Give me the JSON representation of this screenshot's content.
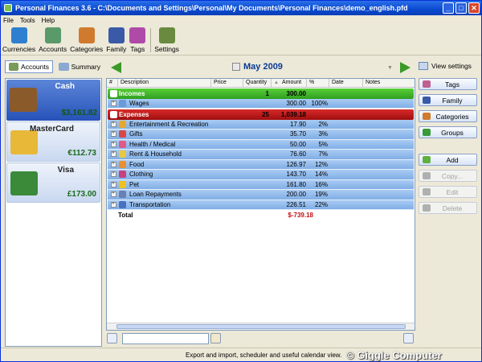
{
  "window": {
    "title": "Personal Finances 3.6 - C:\\Documents and Settings\\Personal\\My Documents\\Personal Finances\\demo_english.pfd",
    "minimize": "_",
    "maximize": "□",
    "close": "✕"
  },
  "menu": [
    "File",
    "Tools",
    "Help"
  ],
  "toolbar": [
    {
      "label": "Currencies",
      "icon": "currencies-icon",
      "color": "#2e7fd0"
    },
    {
      "label": "Accounts",
      "icon": "accounts-icon",
      "color": "#5a9a6a"
    },
    {
      "label": "Categories",
      "icon": "categories-icon",
      "color": "#d07a2e"
    },
    {
      "label": "Family",
      "icon": "family-icon",
      "color": "#3a5aa8"
    },
    {
      "label": "Tags",
      "icon": "tags-icon",
      "color": "#b04aa8"
    },
    {
      "label": "Settings",
      "icon": "settings-icon",
      "color": "#6a8a40"
    }
  ],
  "tabs": {
    "accounts": "Accounts",
    "summary": "Summary"
  },
  "month": "May 2009",
  "view_settings": "View settings",
  "accounts": [
    {
      "name": "Cash",
      "balance": "$3,161.82",
      "selected": true,
      "color": "#8a5a2a"
    },
    {
      "name": "MasterCard",
      "balance": "€112.73",
      "selected": false,
      "color": "#e8b838"
    },
    {
      "name": "Visa",
      "balance": "£173.00",
      "selected": false,
      "color": "#3a8a3a"
    }
  ],
  "grid": {
    "headers": [
      "#",
      "Description",
      "Price",
      "Quantity",
      "Amount",
      "%",
      "Date",
      "Notes"
    ],
    "incomes": {
      "label": "Incomes",
      "qty": "1",
      "amount": "300.00"
    },
    "income_rows": [
      {
        "desc": "Wages",
        "amount": "300.00",
        "pct": "100%"
      }
    ],
    "expenses": {
      "label": "Expenses",
      "qty": "25",
      "amount": "1,039.18"
    },
    "expense_rows": [
      {
        "desc": "Entertainment & Recreation",
        "amount": "17.90",
        "pct": "2%",
        "color": "#e8a830"
      },
      {
        "desc": "Gifts",
        "amount": "35.70",
        "pct": "3%",
        "color": "#d84848"
      },
      {
        "desc": "Health / Medical",
        "amount": "50.00",
        "pct": "5%",
        "color": "#e05a8a"
      },
      {
        "desc": "Rent & Household",
        "amount": "76.60",
        "pct": "7%",
        "color": "#e8c840"
      },
      {
        "desc": "Food",
        "amount": "126.97",
        "pct": "12%",
        "color": "#e89030"
      },
      {
        "desc": "Clothing",
        "amount": "143.70",
        "pct": "14%",
        "color": "#c84080"
      },
      {
        "desc": "Pet",
        "amount": "161.80",
        "pct": "16%",
        "color": "#f0c020"
      },
      {
        "desc": "Loan Repayments",
        "amount": "200.00",
        "pct": "19%",
        "color": "#6a80b0"
      },
      {
        "desc": "Transportation",
        "amount": "226.51",
        "pct": "22%",
        "color": "#4a70c0"
      }
    ],
    "total": {
      "label": "Total",
      "amount": "$-739.18"
    }
  },
  "side_buttons": [
    {
      "label": "Tags",
      "color": "#c06090",
      "disabled": false
    },
    {
      "label": "Family",
      "color": "#3a5aa8",
      "disabled": false
    },
    {
      "label": "Categories",
      "color": "#d07a2e",
      "disabled": false
    },
    {
      "label": "Groups",
      "color": "#3a9a3a",
      "disabled": false
    }
  ],
  "action_buttons": [
    {
      "label": "Add",
      "color": "#60b040",
      "disabled": false
    },
    {
      "label": "Copy...",
      "color": "#b0b0b0",
      "disabled": true
    },
    {
      "label": "Edit",
      "color": "#b0b0b0",
      "disabled": true
    },
    {
      "label": "Delete",
      "color": "#b0b0b0",
      "disabled": true
    }
  ],
  "search": {
    "value": ""
  },
  "status": "Export and import, scheduler and useful calendar view.",
  "watermark": "© Giggle Computer"
}
